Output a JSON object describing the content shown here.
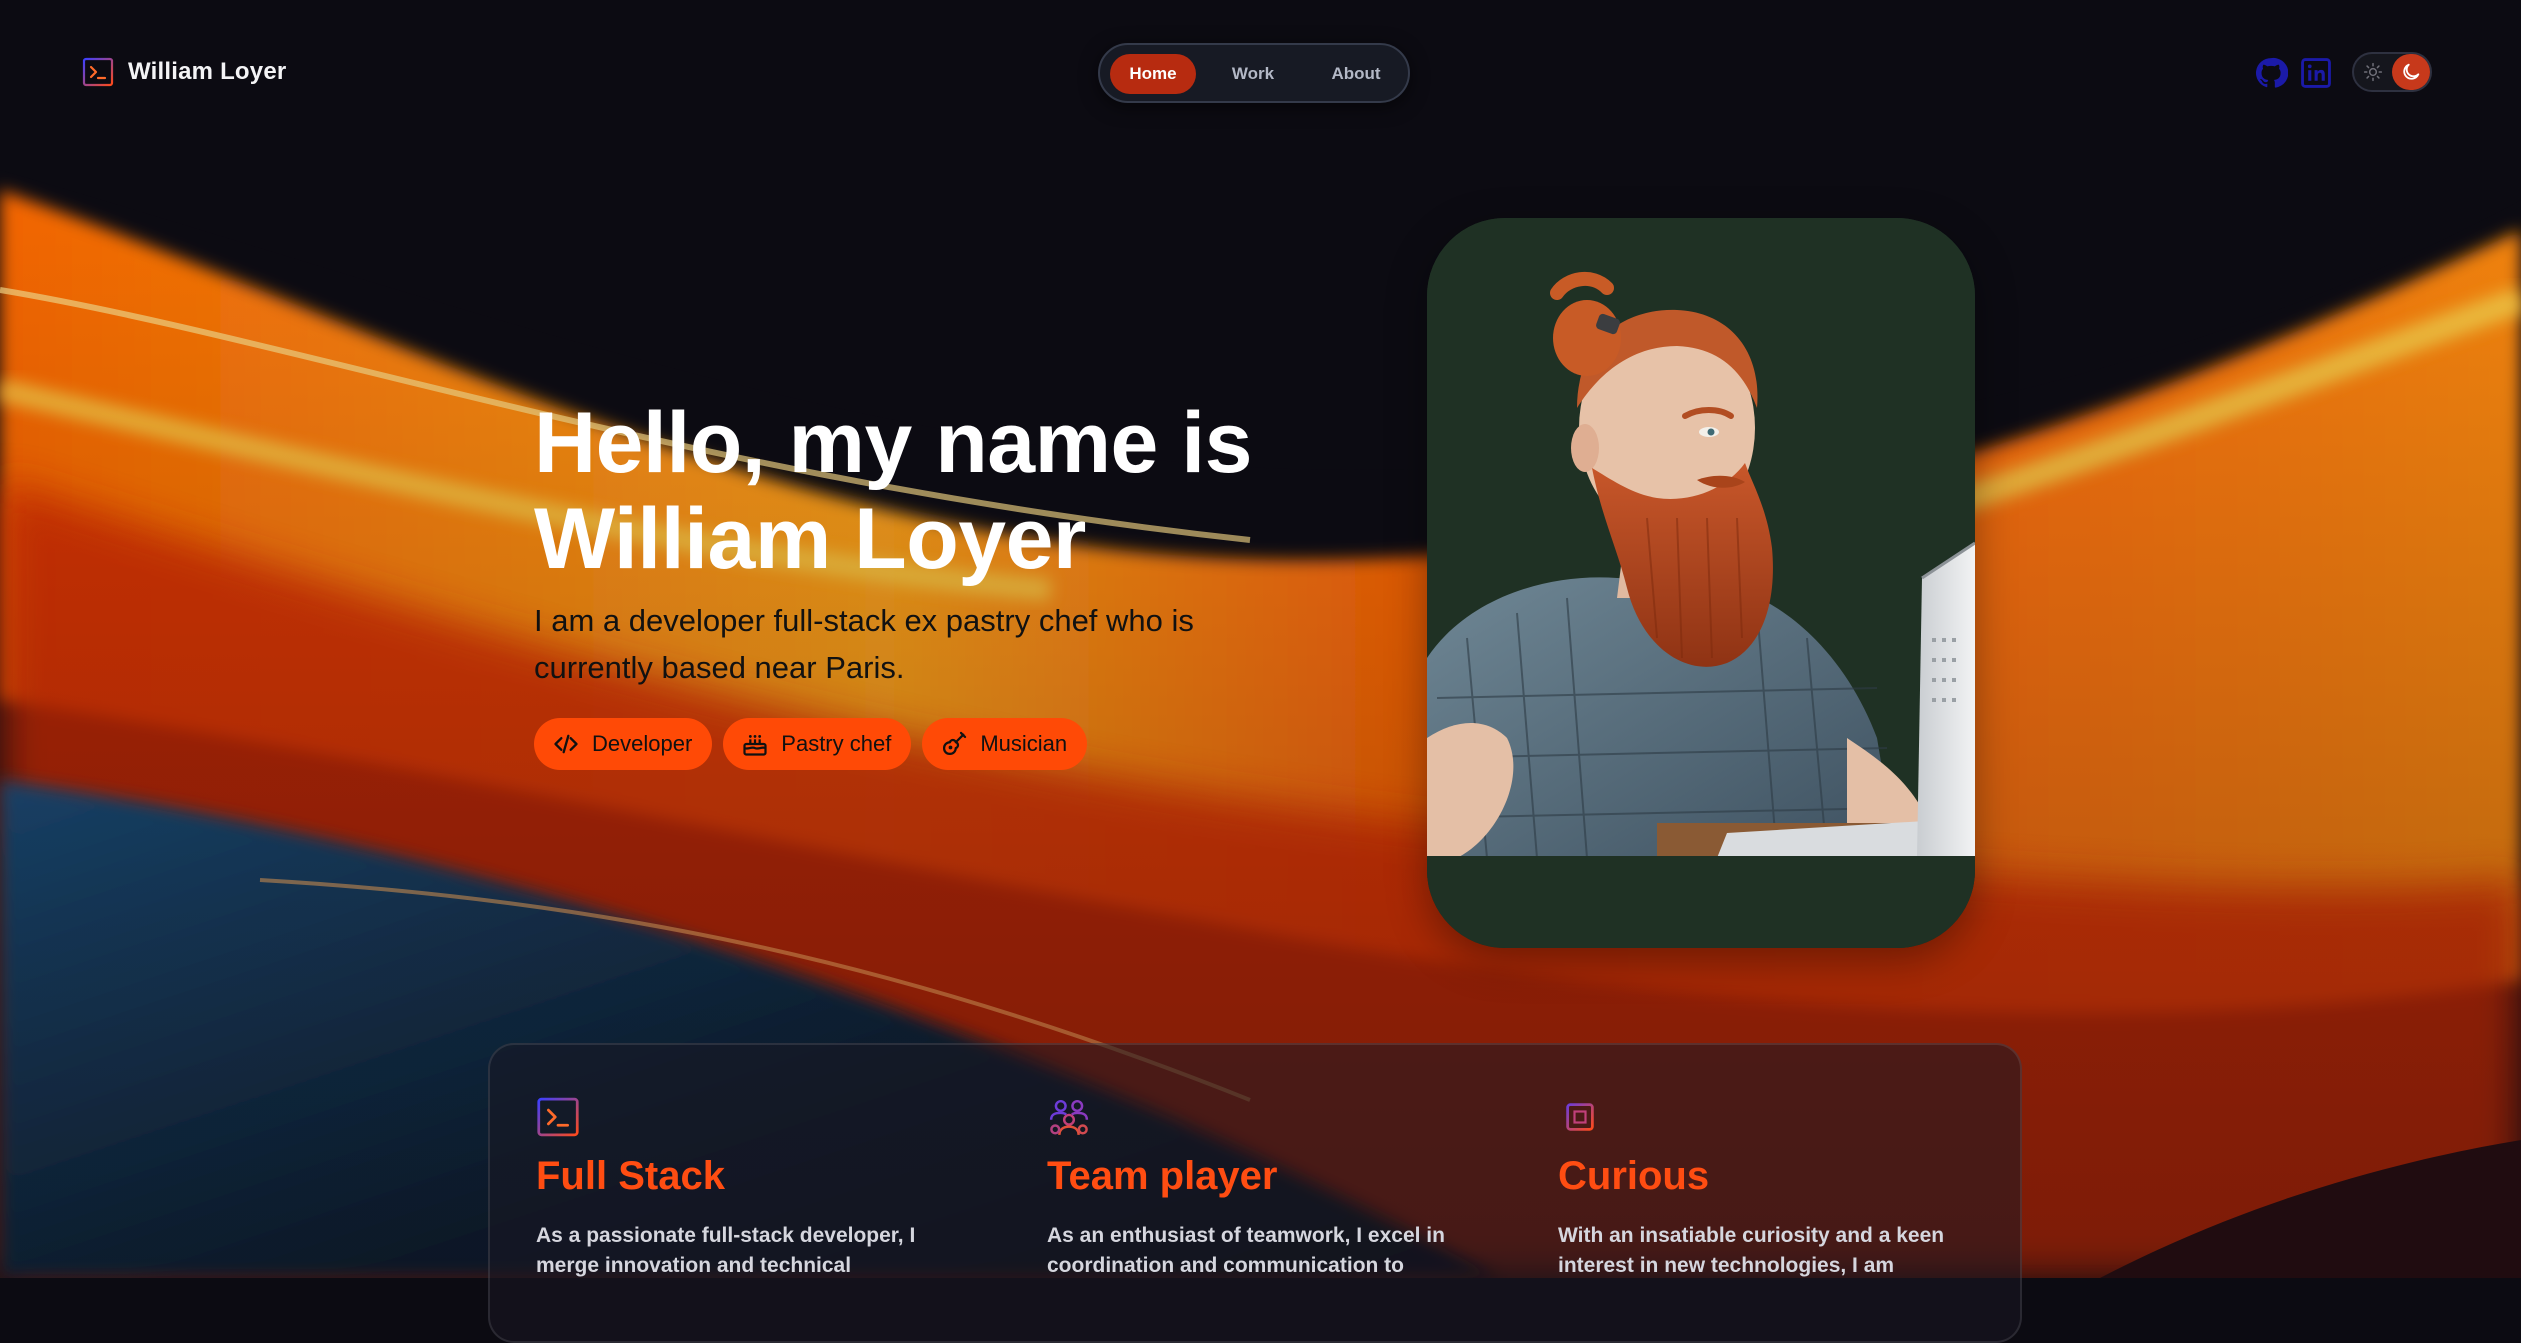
{
  "brand": {
    "name": "William Loyer",
    "icon": "terminal-icon"
  },
  "nav": {
    "items": [
      {
        "label": "Home",
        "active": true
      },
      {
        "label": "Work",
        "active": false
      },
      {
        "label": "About",
        "active": false
      }
    ]
  },
  "header_actions": {
    "github_icon": "github-icon",
    "linkedin_icon": "linkedin-icon",
    "theme": {
      "light_icon": "sun-icon",
      "dark_icon": "moon-icon",
      "selected": "dark"
    }
  },
  "hero": {
    "title_line1": "Hello, my name is",
    "title_line2": "William Loyer",
    "subtitle": "I am a developer full-stack ex pastry chef who is currently based near Paris.",
    "tags": [
      {
        "label": "Developer",
        "icon": "code-icon"
      },
      {
        "label": "Pastry chef",
        "icon": "cake-icon"
      },
      {
        "label": "Musician",
        "icon": "guitar-icon"
      }
    ],
    "portrait": {
      "subject": "portrait-illustration"
    }
  },
  "features": [
    {
      "icon": "terminal-icon",
      "title": "Full Stack",
      "text": "As a passionate full-stack developer, I merge innovation and technical"
    },
    {
      "icon": "team-icon",
      "title": "Team player",
      "text": "As an enthusiast of teamwork, I excel in coordination and communication to"
    },
    {
      "icon": "chip-icon",
      "title": "Curious",
      "text": "With an insatiable curiosity and a keen interest in new technologies, I am"
    }
  ],
  "colors": {
    "accent": "#ff4a06",
    "active_nav": "#b72b10",
    "feature_title": "#ff4d12",
    "background": "#0c0b12",
    "portrait_bg": "#1f3124"
  }
}
